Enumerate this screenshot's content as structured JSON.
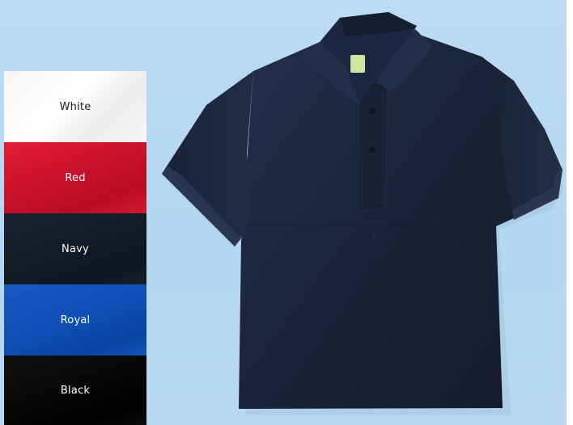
{
  "swatches": [
    {
      "label": "White",
      "color": "#f5f5f5",
      "text_color": "#1a1a1a"
    },
    {
      "label": "Red",
      "color": "#d0142e",
      "text_color": "#ffffff"
    },
    {
      "label": "Navy",
      "color": "#141c28",
      "text_color": "#ffffff"
    },
    {
      "label": "Royal",
      "color": "#1150b8",
      "text_color": "#ffffff"
    },
    {
      "label": "Black",
      "color": "#050505",
      "text_color": "#ffffff"
    }
  ],
  "product": {
    "shirt_color": "#1b2438",
    "background_color": "#b8d8f1"
  }
}
